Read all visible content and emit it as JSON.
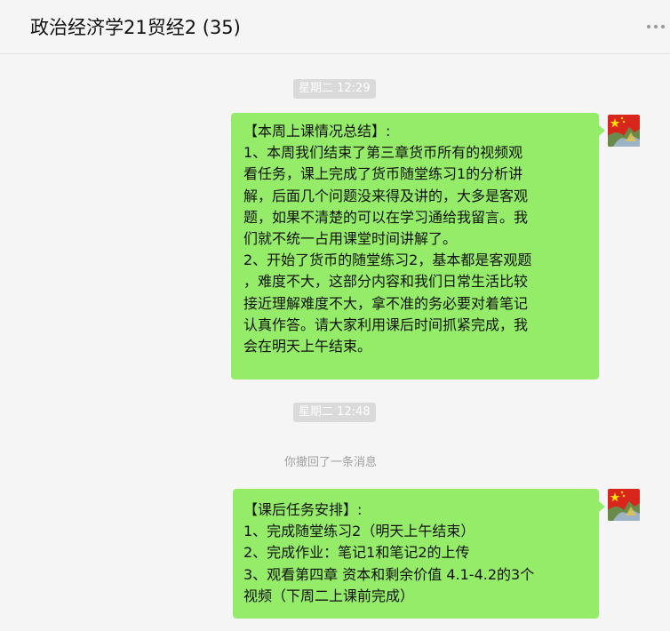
{
  "window": {
    "title": "政治经济学21贸经2 (35)"
  },
  "messages": [
    {
      "type": "time",
      "text": "星期二 12:29"
    },
    {
      "type": "bubble",
      "lines": [
        "【本周上课情况总结】:",
        "1、本周我们结束了第三章货币所有的视频观",
        "看任务，课上完成了货币随堂练习1的分析讲",
        "解，后面几个问题没来得及讲的，大多是客观",
        "题，如果不清楚的可以在学习通给我留言。我",
        "们就不统一占用课堂时间讲解了。",
        "2、开始了货币的随堂练习2，基本都是客观题",
        "，难度不大，这部分内容和我们日常生活比较",
        "接近理解难度不大，拿不准的务必要对着笔记",
        "认真作答。请大家利用课后时间抓紧完成，我",
        "会在明天上午结束。"
      ]
    },
    {
      "type": "time",
      "text": "星期二 12:48"
    },
    {
      "type": "system",
      "text": "你撤回了一条消息"
    },
    {
      "type": "bubble",
      "lines": [
        "【课后任务安排】:",
        "1、完成随堂练习2（明天上午结束）",
        "2、完成作业：笔记1和笔记2的上传",
        "3、观看第四章 资本和剩余价值 4.1-4.2的3个",
        "视频（下周二上课前完成）"
      ]
    }
  ],
  "colors": {
    "bubble": "#95ec69",
    "background": "#f5f5f5",
    "time_pill": "#dadada"
  }
}
